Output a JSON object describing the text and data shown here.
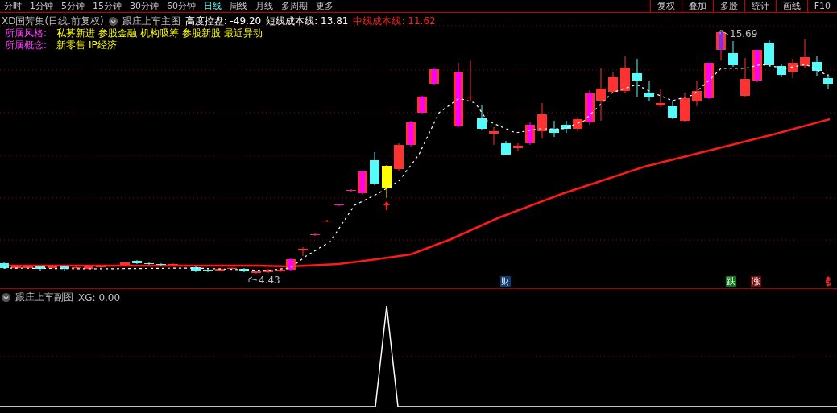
{
  "toolbar": {
    "periods": [
      {
        "label": "分时",
        "selected": false
      },
      {
        "label": "1分钟",
        "selected": false
      },
      {
        "label": "5分钟",
        "selected": false
      },
      {
        "label": "15分钟",
        "selected": false
      },
      {
        "label": "30分钟",
        "selected": false
      },
      {
        "label": "60分钟",
        "selected": false
      },
      {
        "label": "日线",
        "selected": true
      },
      {
        "label": "周线",
        "selected": false
      },
      {
        "label": "月线",
        "selected": false
      },
      {
        "label": "多周期",
        "selected": false
      },
      {
        "label": "更多",
        "selected": false
      }
    ],
    "buttons": [
      "复权",
      "叠加",
      "多股",
      "统计",
      "画线",
      "F10"
    ]
  },
  "main_chart": {
    "stock": "XD国芳集(日线.前复权)",
    "indicator": "跟庄上车主图",
    "readings": [
      {
        "label": "高度控盘:",
        "value": "-49.20",
        "color": "#ffffff"
      },
      {
        "label": "短线成本线:",
        "value": "13.81",
        "color": "#ffffff"
      },
      {
        "label": "中线成本线:",
        "value": "11.62",
        "color": "#ff2020"
      }
    ],
    "style": {
      "label": "所属风格:",
      "tags": [
        "私募新进",
        "参股金融",
        "机构吸筹",
        "参股新股",
        "最近异动"
      ]
    },
    "concept": {
      "label": "所属概念:",
      "tags": [
        "新零售",
        "IP经济"
      ]
    },
    "high_label": "15.69",
    "low_label": "4.43",
    "markers": [
      {
        "text": "财",
        "color": "#0a3d7a"
      },
      {
        "text": "跌",
        "color": "#0a7a14"
      },
      {
        "text": "涨",
        "color": "#7a0a0a"
      }
    ]
  },
  "sub_chart": {
    "indicator": "跟庄上车副图",
    "reading": "XG: 0.00"
  }
}
